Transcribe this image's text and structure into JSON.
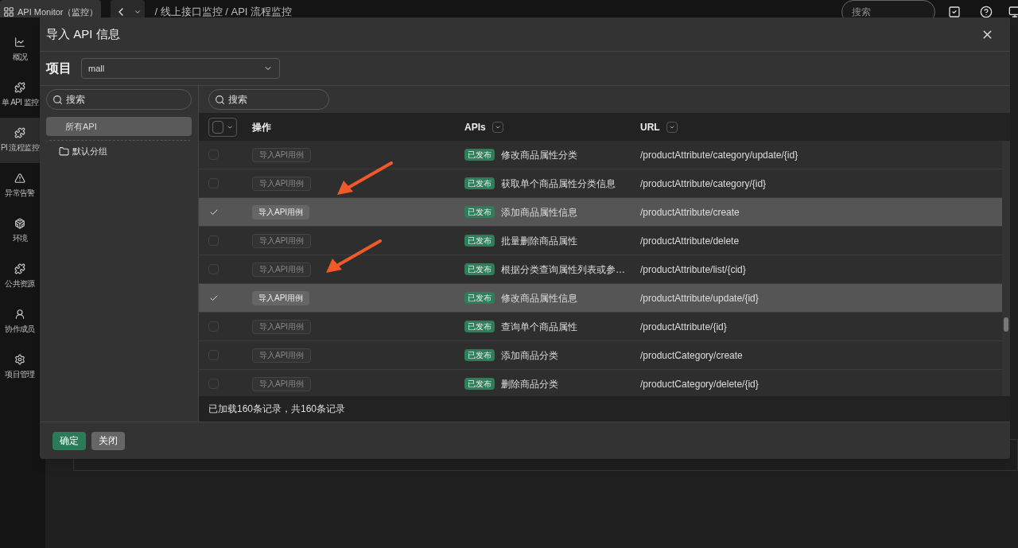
{
  "topbar": {
    "app_switcher": "API Monitor（监控）",
    "breadcrumb": "/ 线上接口监控 / API 流程监控",
    "search": {
      "placeholder": "搜索"
    }
  },
  "sidebar": {
    "items": [
      {
        "kind": "chart",
        "label": "概况",
        "selected": false
      },
      {
        "kind": "puzzle",
        "label": "单 API 监控",
        "selected": false
      },
      {
        "kind": "puzzle",
        "label": "PI 流程监控",
        "selected": true
      },
      {
        "kind": "warning",
        "label": "异常告警",
        "selected": false
      },
      {
        "kind": "cube",
        "label": "环境",
        "selected": false
      },
      {
        "kind": "puzzle",
        "label": "公共资源",
        "selected": false
      },
      {
        "kind": "user",
        "label": "协作成员",
        "selected": false
      },
      {
        "kind": "gear",
        "label": "项目管理",
        "selected": false
      }
    ]
  },
  "dialog": {
    "title": "导入 API 信息",
    "project": {
      "label": "项目",
      "value": "mall"
    },
    "groups": {
      "search": {
        "placeholder": "搜索"
      },
      "items": [
        {
          "label": "所有API",
          "selected": true,
          "kind": "all"
        },
        {
          "label": "默认分组",
          "selected": false,
          "kind": "folder"
        }
      ]
    },
    "table": {
      "search": {
        "placeholder": "搜索"
      },
      "all_checked": false,
      "columns": [
        "操作",
        "APIs",
        "URL"
      ],
      "rows": [
        {
          "checked": false,
          "action": "导入API用例",
          "status": "已发布",
          "name": "修改商品属性分类",
          "url": "/productAttribute/category/update/{id}"
        },
        {
          "checked": false,
          "action": "导入API用例",
          "status": "已发布",
          "name": "获取单个商品属性分类信息",
          "url": "/productAttribute/category/{id}"
        },
        {
          "checked": true,
          "action": "导入API用例",
          "status": "已发布",
          "name": "添加商品属性信息",
          "url": "/productAttribute/create"
        },
        {
          "checked": false,
          "action": "导入API用例",
          "status": "已发布",
          "name": "批量删除商品属性",
          "url": "/productAttribute/delete"
        },
        {
          "checked": false,
          "action": "导入API用例",
          "status": "已发布",
          "name": "根据分类查询属性列表或参…",
          "url": "/productAttribute/list/{cid}"
        },
        {
          "checked": true,
          "action": "导入API用例",
          "status": "已发布",
          "name": "修改商品属性信息",
          "url": "/productAttribute/update/{id}"
        },
        {
          "checked": false,
          "action": "导入API用例",
          "status": "已发布",
          "name": "查询单个商品属性",
          "url": "/productAttribute/{id}"
        },
        {
          "checked": false,
          "action": "导入API用例",
          "status": "已发布",
          "name": "添加商品分类",
          "url": "/productCategory/create"
        },
        {
          "checked": false,
          "action": "导入API用例",
          "status": "已发布",
          "name": "删除商品分类",
          "url": "/productCategory/delete/{id}"
        }
      ],
      "footer": "已加载160条记录，共160条记录"
    },
    "buttons": [
      {
        "label": "确定",
        "kind": "primary"
      },
      {
        "label": "关闭",
        "kind": "secondary"
      }
    ]
  }
}
